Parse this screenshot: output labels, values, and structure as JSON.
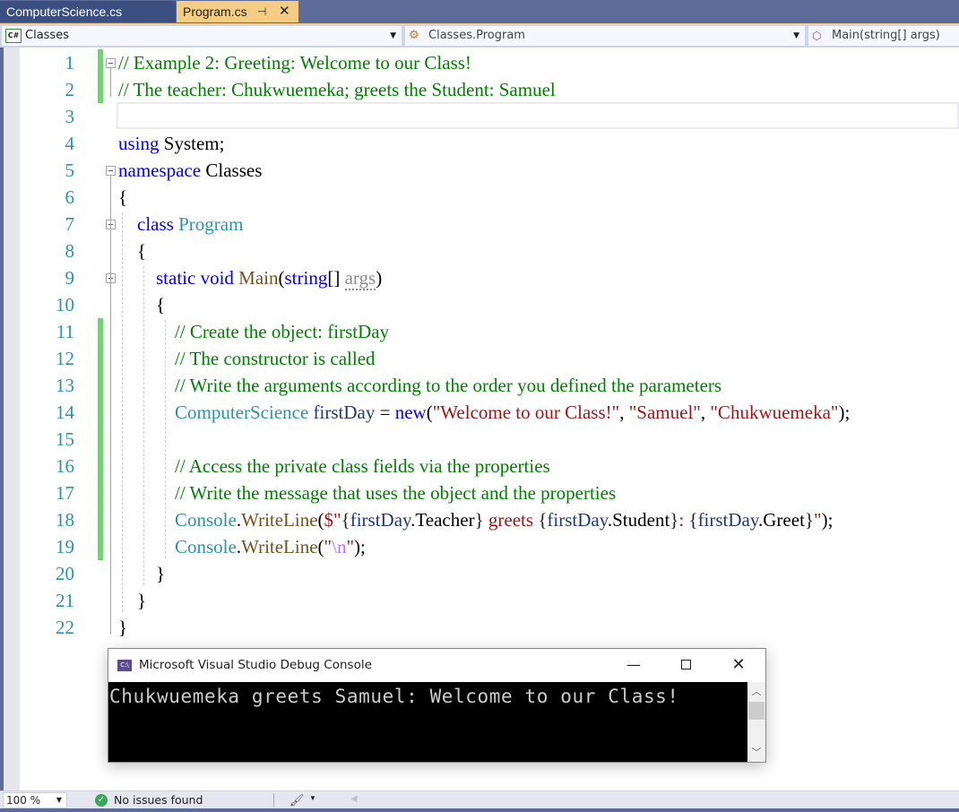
{
  "tabs": [
    {
      "label": "ComputerScience.cs",
      "active": false
    },
    {
      "label": "Program.cs",
      "active": true,
      "pin_icon": "pin-icon",
      "close_icon": "close-icon"
    }
  ],
  "navbar": {
    "project": {
      "label": "Classes",
      "icon": "csharp-project-icon"
    },
    "type": {
      "label": "Classes.Program",
      "icon": "class-icon"
    },
    "member": {
      "label": "Main(string[] args)",
      "icon": "private-method-icon"
    }
  },
  "editor": {
    "line_numbers": [
      "1",
      "2",
      "3",
      "4",
      "5",
      "6",
      "7",
      "8",
      "9",
      "10",
      "11",
      "12",
      "13",
      "14",
      "15",
      "16",
      "17",
      "18",
      "19",
      "20",
      "21",
      "22"
    ],
    "lines": [
      [
        {
          "t": "// Example 2: Greeting: Welcome to our Class!",
          "c": "com"
        }
      ],
      [
        {
          "t": "// The teacher: Chukwuemeka; greets the Student: Samuel",
          "c": "com"
        }
      ],
      [],
      [
        {
          "t": "using",
          "c": "kw"
        },
        {
          "t": " System;",
          "c": ""
        }
      ],
      [
        {
          "t": "namespace",
          "c": "kw"
        },
        {
          "t": " Classes",
          "c": ""
        }
      ],
      [
        {
          "t": "{",
          "c": ""
        }
      ],
      [
        {
          "t": "    class",
          "c": "kw"
        },
        {
          "t": " ",
          "c": ""
        },
        {
          "t": "Program",
          "c": "type"
        }
      ],
      [
        {
          "t": "    {",
          "c": ""
        }
      ],
      [
        {
          "t": "        static void",
          "c": "kw"
        },
        {
          "t": " ",
          "c": ""
        },
        {
          "t": "Main",
          "c": "meth"
        },
        {
          "t": "(",
          "c": ""
        },
        {
          "t": "string",
          "c": "kw"
        },
        {
          "t": "[] ",
          "c": ""
        },
        {
          "t": "args",
          "c": "unused"
        },
        {
          "t": ")",
          "c": ""
        }
      ],
      [
        {
          "t": "        {",
          "c": ""
        }
      ],
      [
        {
          "t": "            // Create the object: firstDay",
          "c": "com"
        }
      ],
      [
        {
          "t": "            // The constructor is called",
          "c": "com"
        }
      ],
      [
        {
          "t": "            // Write the arguments according to the order you defined the parameters",
          "c": "com"
        }
      ],
      [
        {
          "t": "            ",
          "c": ""
        },
        {
          "t": "ComputerScience",
          "c": "type"
        },
        {
          "t": " ",
          "c": ""
        },
        {
          "t": "firstDay",
          "c": "var"
        },
        {
          "t": " = ",
          "c": ""
        },
        {
          "t": "new",
          "c": "kw"
        },
        {
          "t": "(",
          "c": ""
        },
        {
          "t": "\"Welcome to our Class!\"",
          "c": "str"
        },
        {
          "t": ", ",
          "c": ""
        },
        {
          "t": "\"Samuel\"",
          "c": "str"
        },
        {
          "t": ", ",
          "c": ""
        },
        {
          "t": "\"Chukwuemeka\"",
          "c": "str"
        },
        {
          "t": ");",
          "c": ""
        }
      ],
      [],
      [
        {
          "t": "            // Access the private class fields via the properties",
          "c": "com"
        }
      ],
      [
        {
          "t": "            // Write the message that uses the object and the properties",
          "c": "com"
        }
      ],
      [
        {
          "t": "            ",
          "c": ""
        },
        {
          "t": "Console",
          "c": "type"
        },
        {
          "t": ".",
          "c": ""
        },
        {
          "t": "WriteLine",
          "c": "meth"
        },
        {
          "t": "(",
          "c": ""
        },
        {
          "t": "$\"",
          "c": "str"
        },
        {
          "t": "{",
          "c": "interp"
        },
        {
          "t": "firstDay",
          "c": "var"
        },
        {
          "t": ".Teacher",
          "c": ""
        },
        {
          "t": "}",
          "c": "interp"
        },
        {
          "t": " greets ",
          "c": "str"
        },
        {
          "t": "{",
          "c": "interp"
        },
        {
          "t": "firstDay",
          "c": "var"
        },
        {
          "t": ".Student",
          "c": ""
        },
        {
          "t": "}",
          "c": "interp"
        },
        {
          "t": ": ",
          "c": "str"
        },
        {
          "t": "{",
          "c": "interp"
        },
        {
          "t": "firstDay",
          "c": "var"
        },
        {
          "t": ".Greet",
          "c": ""
        },
        {
          "t": "}",
          "c": "interp"
        },
        {
          "t": "\"",
          "c": "str"
        },
        {
          "t": ");",
          "c": ""
        }
      ],
      [
        {
          "t": "            ",
          "c": ""
        },
        {
          "t": "Console",
          "c": "type"
        },
        {
          "t": ".",
          "c": ""
        },
        {
          "t": "WriteLine",
          "c": "meth"
        },
        {
          "t": "(",
          "c": ""
        },
        {
          "t": "\"",
          "c": "str"
        },
        {
          "t": "\\n",
          "c": "esc"
        },
        {
          "t": "\"",
          "c": "str"
        },
        {
          "t": ");",
          "c": ""
        }
      ],
      [
        {
          "t": "        }",
          "c": ""
        }
      ],
      [
        {
          "t": "    }",
          "c": ""
        }
      ],
      [
        {
          "t": "}",
          "c": ""
        }
      ]
    ],
    "changed_lines": [
      [
        1,
        2
      ],
      [
        11,
        19
      ]
    ]
  },
  "console": {
    "title": "Microsoft Visual Studio Debug Console",
    "icon": "console-app-icon",
    "output": "Chukwuemeka greets Samuel: Welcome to our Class!",
    "minimize_label": "—",
    "close_label": "✕"
  },
  "statusbar": {
    "zoom": "100 %",
    "issues": "No issues found",
    "issues_icon": "check-circle-icon",
    "cleanup_icon": "brush-icon"
  },
  "colors": {
    "accent_tab": "#f5cc84",
    "frame": "#5d6b99",
    "comment": "#008000",
    "keyword": "#0000ff",
    "type": "#2b91af",
    "string": "#a31515",
    "change_bar": "#6ed66e"
  }
}
